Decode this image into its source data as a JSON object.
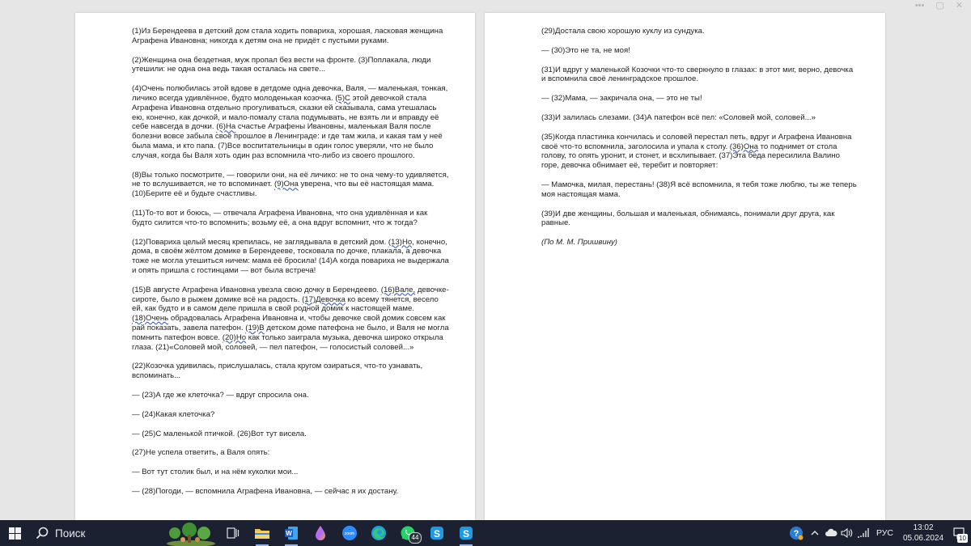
{
  "document": {
    "left_page": [
      [
        {
          "t": "(1)Из Берендеева в детский дом стала ходить повариха, хорошая, ласковая женщина Аграфена Ивановна; никогда к детям она не придёт с пустыми руками."
        }
      ],
      [
        {
          "t": "(2)Женщина она бездетная, муж пропал без вести на фронте. (3)Поплакала, люди утешили: не одна она ведь такая осталась на свете..."
        }
      ],
      [
        {
          "t": "(4)Очень полюбилась этой вдове в детдоме одна девочка, Валя, — маленькая, тонкая, личико всегда удивлённое, будто молоденькая козочка. "
        },
        {
          "t": "(5)С",
          "u": true
        },
        {
          "t": " этой девочкой стала Аграфена Ивановна отдельно прогуливаться, сказки ей сказывала, сама утешалась ею, конечно, как дочкой, и мало-помалу стала подумывать, не взять ли и вправду её себе навсегда в дочки. "
        },
        {
          "t": "(6)На",
          "u": true
        },
        {
          "t": " счастье Аграфены Ивановны, маленькая Валя после болезни вовсе забыла своё прошлое в Ленинграде: и где там жила, и какая там у неё была мама, и кто папа. (7)Все воспитательницы в один голос уверяли, что не было случая, когда бы Валя хоть один раз вспомнила что-либо из своего прошлого."
        }
      ],
      [
        {
          "t": "(8)Вы только посмотрите, — говорили они, на её личико: не то она чему-то удивляется, не то вслушивается, не то вспоминает. "
        },
        {
          "t": "(9)Она",
          "u": true
        },
        {
          "t": " уверена, что вы её настоящая мама. (10)Берите её и будьте счастливы."
        }
      ],
      [
        {
          "t": "(11)То-то вот и боюсь, — отвечала Аграфена Ивановна, что она удивлённая и как будто силится что-то вспомнить; возьму её, а она вдруг вспомнит, что ж тогда?"
        }
      ],
      [
        {
          "t": "(12)Повариха целый месяц крепилась, не заглядывала в детский дом. "
        },
        {
          "t": "(13)Но,",
          "u": true
        },
        {
          "t": " конечно, дома, в своём жёлтом домике в Берендееве, тосковала по дочке, плакала, а девочка тоже не могла утешиться ничем: мама её бросила! (14)А когда повариха не выдержала и опять пришла с гостинцами — вот была встреча!"
        }
      ],
      [
        {
          "t": "(15)В августе Аграфена Ивановна увезла свою дочку в Берендеево. "
        },
        {
          "t": "(16)Вале,",
          "u": true
        },
        {
          "t": " девочке-сироте, было в рыжем домике всё на радость. "
        },
        {
          "t": "(17)Девочка",
          "u": true
        },
        {
          "t": " ко всему тянется, весело ей, как будто и в самом деле пришла в свой родной домик к настоящей маме. "
        },
        {
          "t": "(18)Очень",
          "u": true
        },
        {
          "t": " обрадовалась Аграфена Ивановна и, чтобы девочке свой домик совсем как рай показать, завела патефон. "
        },
        {
          "t": "(19)В",
          "u": true
        },
        {
          "t": " детском доме патефона не было, и Валя не могла помнить патефон вовсе. "
        },
        {
          "t": "(20)Но",
          "u": true
        },
        {
          "t": " как только заиграла музыка, девочка широко открыла глаза. (21)«Соловей мой, соловей, — пел патефон, — голосистый соловей...»"
        }
      ],
      [
        {
          "t": "(22)Козочка удивилась, прислушалась, стала кругом озираться, что-то узнавать, вспоминать..."
        }
      ],
      [
        {
          "t": "— (23)А где же клеточка? — вдруг спросила она."
        }
      ],
      [
        {
          "t": "— (24)Какая клеточка?"
        }
      ],
      [
        {
          "t": "— (25)С маленькой птичкой. (26)Вот тут висела."
        }
      ],
      [
        {
          "t": "(27)Не успела ответить, а Валя опять:"
        }
      ],
      [
        {
          "t": "— Вот тут столик был, и на нём куколки мои..."
        }
      ],
      [
        {
          "t": "— (28)Погоди, — вспомнила Аграфена Ивановна, — сейчас я их достану."
        }
      ]
    ],
    "right_page": [
      [
        {
          "t": "(29)Достала свою хорошую куклу из сундука."
        }
      ],
      [
        {
          "t": "— (30)Это не та, не моя!"
        }
      ],
      [
        {
          "t": "(31)И вдруг у маленькой Козочки что-то сверкнуло в глазах: в этот миг, верно, девочка и вспомнила своё ленинградское прошлое."
        }
      ],
      [
        {
          "t": "— (32)Мама, — закричала она, — это не ты!"
        }
      ],
      [
        {
          "t": "(33)И залилась слезами. (34)А патефон всё пел: «Соловей мой, соловей...»"
        }
      ],
      [
        {
          "t": "(35)Когда пластинка кончилась и соловей перестал петь, вдруг и Аграфена Ивановна своё что-то вспомнила, заголосила и упала к столу. "
        },
        {
          "t": "(36)Она",
          "u": true
        },
        {
          "t": " то поднимет от стола голову, то опять уронит, и стонет, и всхлипывает. (37)Эта беда пересилила Валино горе, девочка обнимает её, теребит и повторяет:"
        }
      ],
      [
        {
          "t": "— Мамочка, милая, перестань! (38)Я всё вспомнила, я тебя тоже люблю, ты же теперь моя настоящая мама."
        }
      ],
      [
        {
          "t": "(39)И две женщины, большая и маленькая, обнимаясь, понимали друг друга, как равные."
        }
      ],
      [
        {
          "t": "(По М. М. Пришвину)",
          "i": true
        }
      ]
    ]
  },
  "taskbar": {
    "search_label": "Поиск",
    "apps": [
      {
        "name": "task-view",
        "icon": "task-view-icon"
      },
      {
        "name": "file-explorer",
        "icon": "folder-icon"
      },
      {
        "name": "word",
        "icon": "word-icon"
      },
      {
        "name": "app-drop",
        "icon": "drop-icon"
      },
      {
        "name": "zoom",
        "icon": "zoom-icon",
        "label": "zoom"
      },
      {
        "name": "edge",
        "icon": "edge-icon"
      },
      {
        "name": "whatsapp",
        "icon": "whatsapp-icon",
        "badge": "44"
      },
      {
        "name": "skype-1",
        "icon": "skype-icon"
      },
      {
        "name": "skype-2",
        "icon": "skype-icon"
      }
    ],
    "tray": {
      "language": "РУС",
      "time": "13:02",
      "date": "05.06.2024",
      "notifications": "10"
    }
  },
  "colors": {
    "taskbar_bg": "#1b2130",
    "workspace_bg": "#e6e6e6",
    "page_bg": "#ffffff",
    "accent": "#2b7cd3"
  }
}
